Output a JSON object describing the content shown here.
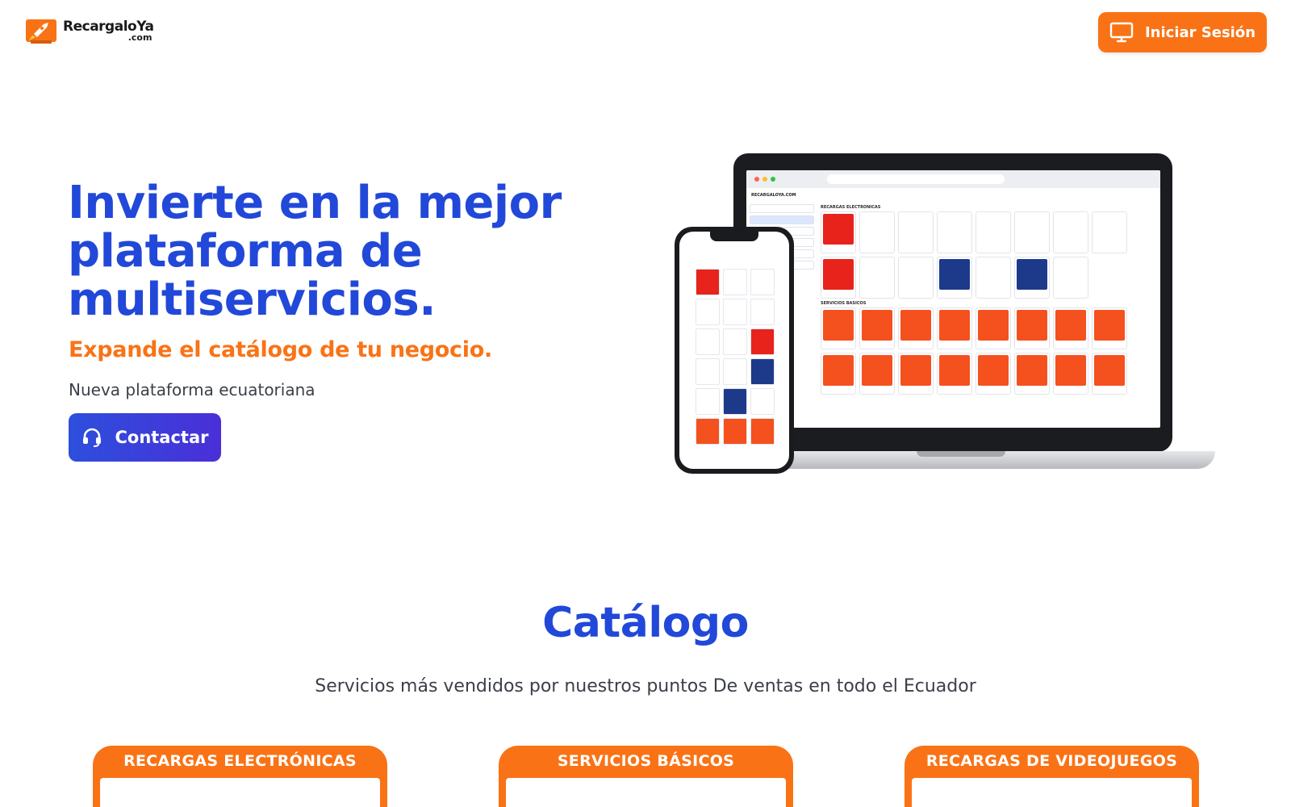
{
  "header": {
    "logo_name": "RecargaloYa",
    "logo_tld": ".com",
    "login_label": "Iniciar Sesión",
    "accent_color": "#f97316",
    "brand_color": "#2148d8"
  },
  "hero": {
    "title": "Invierte en la mejor plataforma de multiservicios.",
    "subtitle": "Expande el catálogo de tu negocio.",
    "tagline": "Nueva plataforma ecuatoriana",
    "contact_label": "Contactar",
    "contact_icon": "headset-icon"
  },
  "mockup": {
    "site_label": "RECARGALOYA.COM",
    "section_recargas": "RECARGAS ELECTRONICAS",
    "section_servicios": "SERVICIOS BASICOS"
  },
  "catalog": {
    "title": "Catálogo",
    "subtitle": "Servicios más vendidos por nuestros puntos De ventas en todo el Ecuador",
    "cards": [
      {
        "label": "RECARGAS ELECTRÓNICAS"
      },
      {
        "label": "SERVICIOS BÁSICOS"
      },
      {
        "label": "RECARGAS DE VIDEOJUEGOS"
      }
    ]
  }
}
